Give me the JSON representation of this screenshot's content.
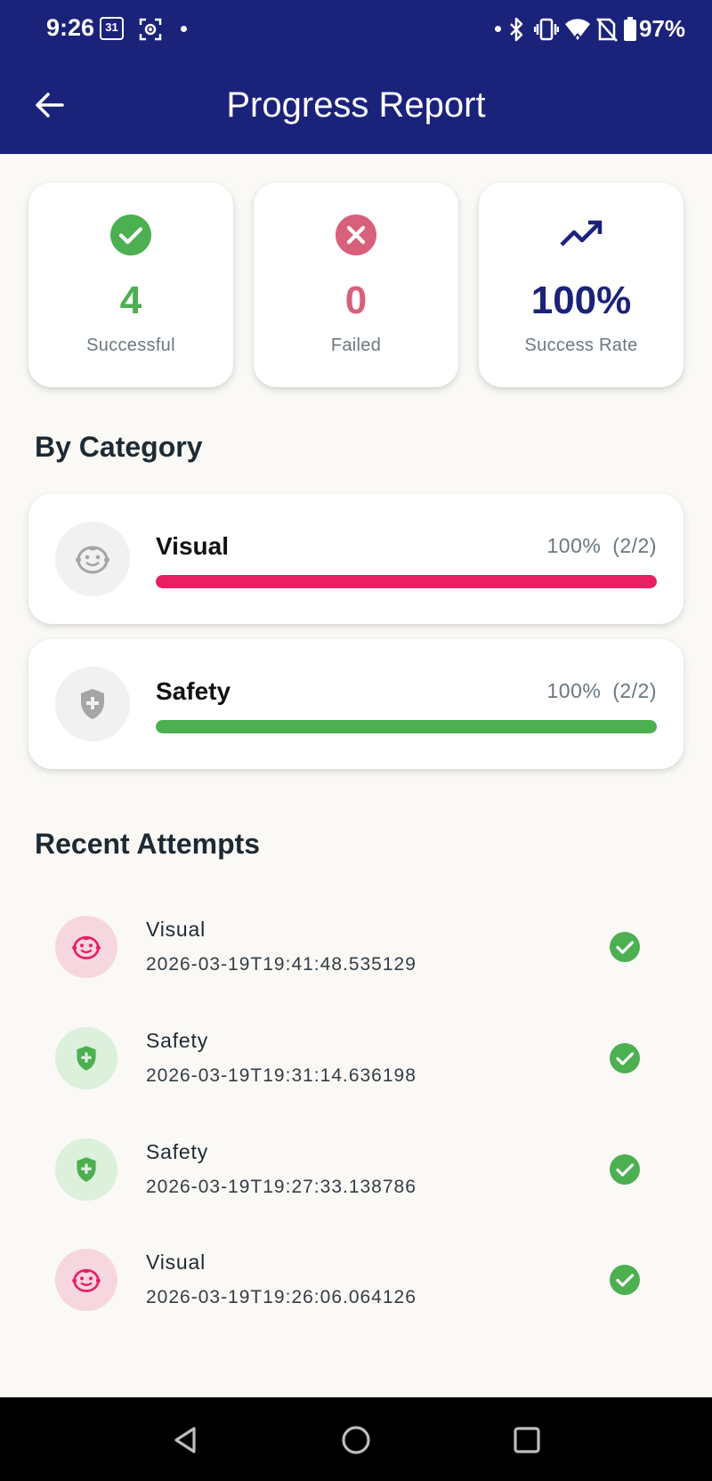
{
  "status_bar": {
    "time": "9:26",
    "calendar_day": "31",
    "battery": "97%",
    "icons": [
      "calendar-icon",
      "screenshot-icon",
      "bluetooth-icon",
      "vibrate-icon",
      "wifi-icon",
      "no-sim-icon",
      "battery-icon"
    ]
  },
  "app_bar": {
    "title": "Progress Report",
    "back_icon": "arrow-back-icon"
  },
  "stats": [
    {
      "icon": "check-circle-icon",
      "value": "4",
      "label": "Successful",
      "color": "#4caf50"
    },
    {
      "icon": "cancel-circle-icon",
      "value": "0",
      "label": "Failed",
      "color": "#d9607a"
    },
    {
      "icon": "trending-up-icon",
      "value": "100%",
      "label": "Success Rate",
      "color": "#1b227a"
    }
  ],
  "by_category": {
    "title": "By Category",
    "items": [
      {
        "name": "Visual",
        "percent": "100%",
        "fraction": "(2/2)",
        "progress": 1.0,
        "color": "#e91e63",
        "icon": "baby-face-icon"
      },
      {
        "name": "Safety",
        "percent": "100%",
        "fraction": "(2/2)",
        "progress": 1.0,
        "color": "#4caf50",
        "icon": "shield-plus-icon"
      }
    ]
  },
  "recent_attempts": {
    "title": "Recent Attempts",
    "items": [
      {
        "category": "Visual",
        "timestamp": "2026-03-19T19:41:48.535129",
        "icon": "baby-face-icon",
        "result_icon": "check-circle-icon"
      },
      {
        "category": "Safety",
        "timestamp": "2026-03-19T19:31:14.636198",
        "icon": "shield-plus-icon",
        "result_icon": "check-circle-icon"
      },
      {
        "category": "Safety",
        "timestamp": "2026-03-19T19:27:33.138786",
        "icon": "shield-plus-icon",
        "result_icon": "check-circle-icon"
      },
      {
        "category": "Visual",
        "timestamp": "2026-03-19T19:26:06.064126",
        "icon": "baby-face-icon",
        "result_icon": "check-circle-icon"
      }
    ]
  },
  "colors": {
    "app_bar": "#1b227a",
    "background": "#faf9f6",
    "success": "#4caf50",
    "failed": "#d9607a",
    "visual": "#e91e63",
    "safety": "#4caf50"
  },
  "nav_bar": [
    "back-triangle-icon",
    "home-circle-icon",
    "recents-square-icon"
  ]
}
